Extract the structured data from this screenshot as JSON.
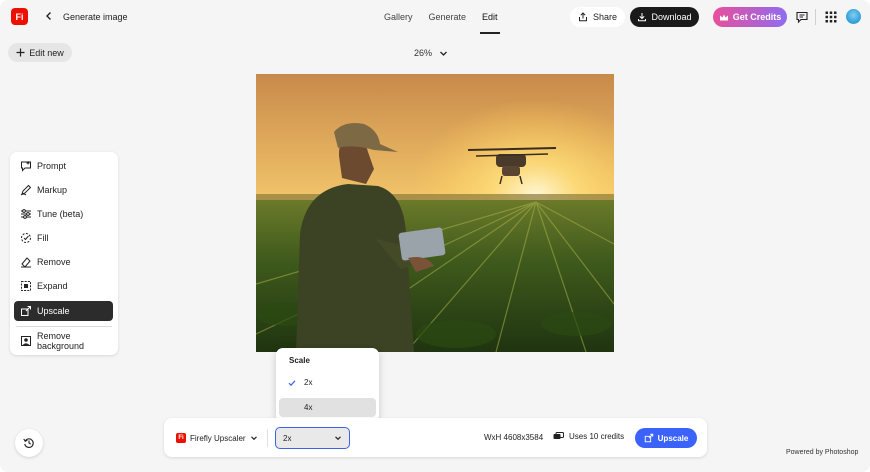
{
  "header": {
    "logo_text": "Fi",
    "title": "Generate image",
    "tabs": [
      {
        "label": "Gallery",
        "active": false
      },
      {
        "label": "Generate",
        "active": false
      },
      {
        "label": "Edit",
        "active": true
      }
    ],
    "share_label": "Share",
    "download_label": "Download",
    "credits_label": "Get Credits"
  },
  "toolbar": {
    "edit_new_label": "Edit new",
    "zoom": "26%"
  },
  "tools": [
    {
      "label": "Prompt",
      "icon": "prompt-icon",
      "active": false
    },
    {
      "label": "Markup",
      "icon": "markup-icon",
      "active": false
    },
    {
      "label": "Tune (beta)",
      "icon": "tune-icon",
      "active": false
    },
    {
      "label": "Fill",
      "icon": "fill-icon",
      "active": false
    },
    {
      "label": "Remove",
      "icon": "remove-icon",
      "active": false
    },
    {
      "label": "Expand",
      "icon": "expand-icon",
      "active": false
    },
    {
      "label": "Upscale",
      "icon": "upscale-icon",
      "active": true
    },
    {
      "label": "Remove background",
      "icon": "remove-background-icon",
      "active": false
    }
  ],
  "scale_popup": {
    "heading": "Scale",
    "options": [
      {
        "label": "2x",
        "selected": true
      },
      {
        "label": "4x",
        "selected": false
      }
    ],
    "tooltip": "4x"
  },
  "bottom": {
    "model_logo": "Fi",
    "model_label": "Firefly Upscaler",
    "scale_value": "2x",
    "dimensions": "WxH 4608x3584",
    "uses_credits": "Uses 10 credits",
    "upscale_label": "Upscale"
  },
  "footer": {
    "powered_by": "Powered by Photoshop"
  },
  "colors": {
    "brand_red": "#eb1000",
    "accent_blue": "#3b63fb",
    "credits_gradient_start": "#e84f9b",
    "credits_gradient_end": "#8f6cf0"
  }
}
